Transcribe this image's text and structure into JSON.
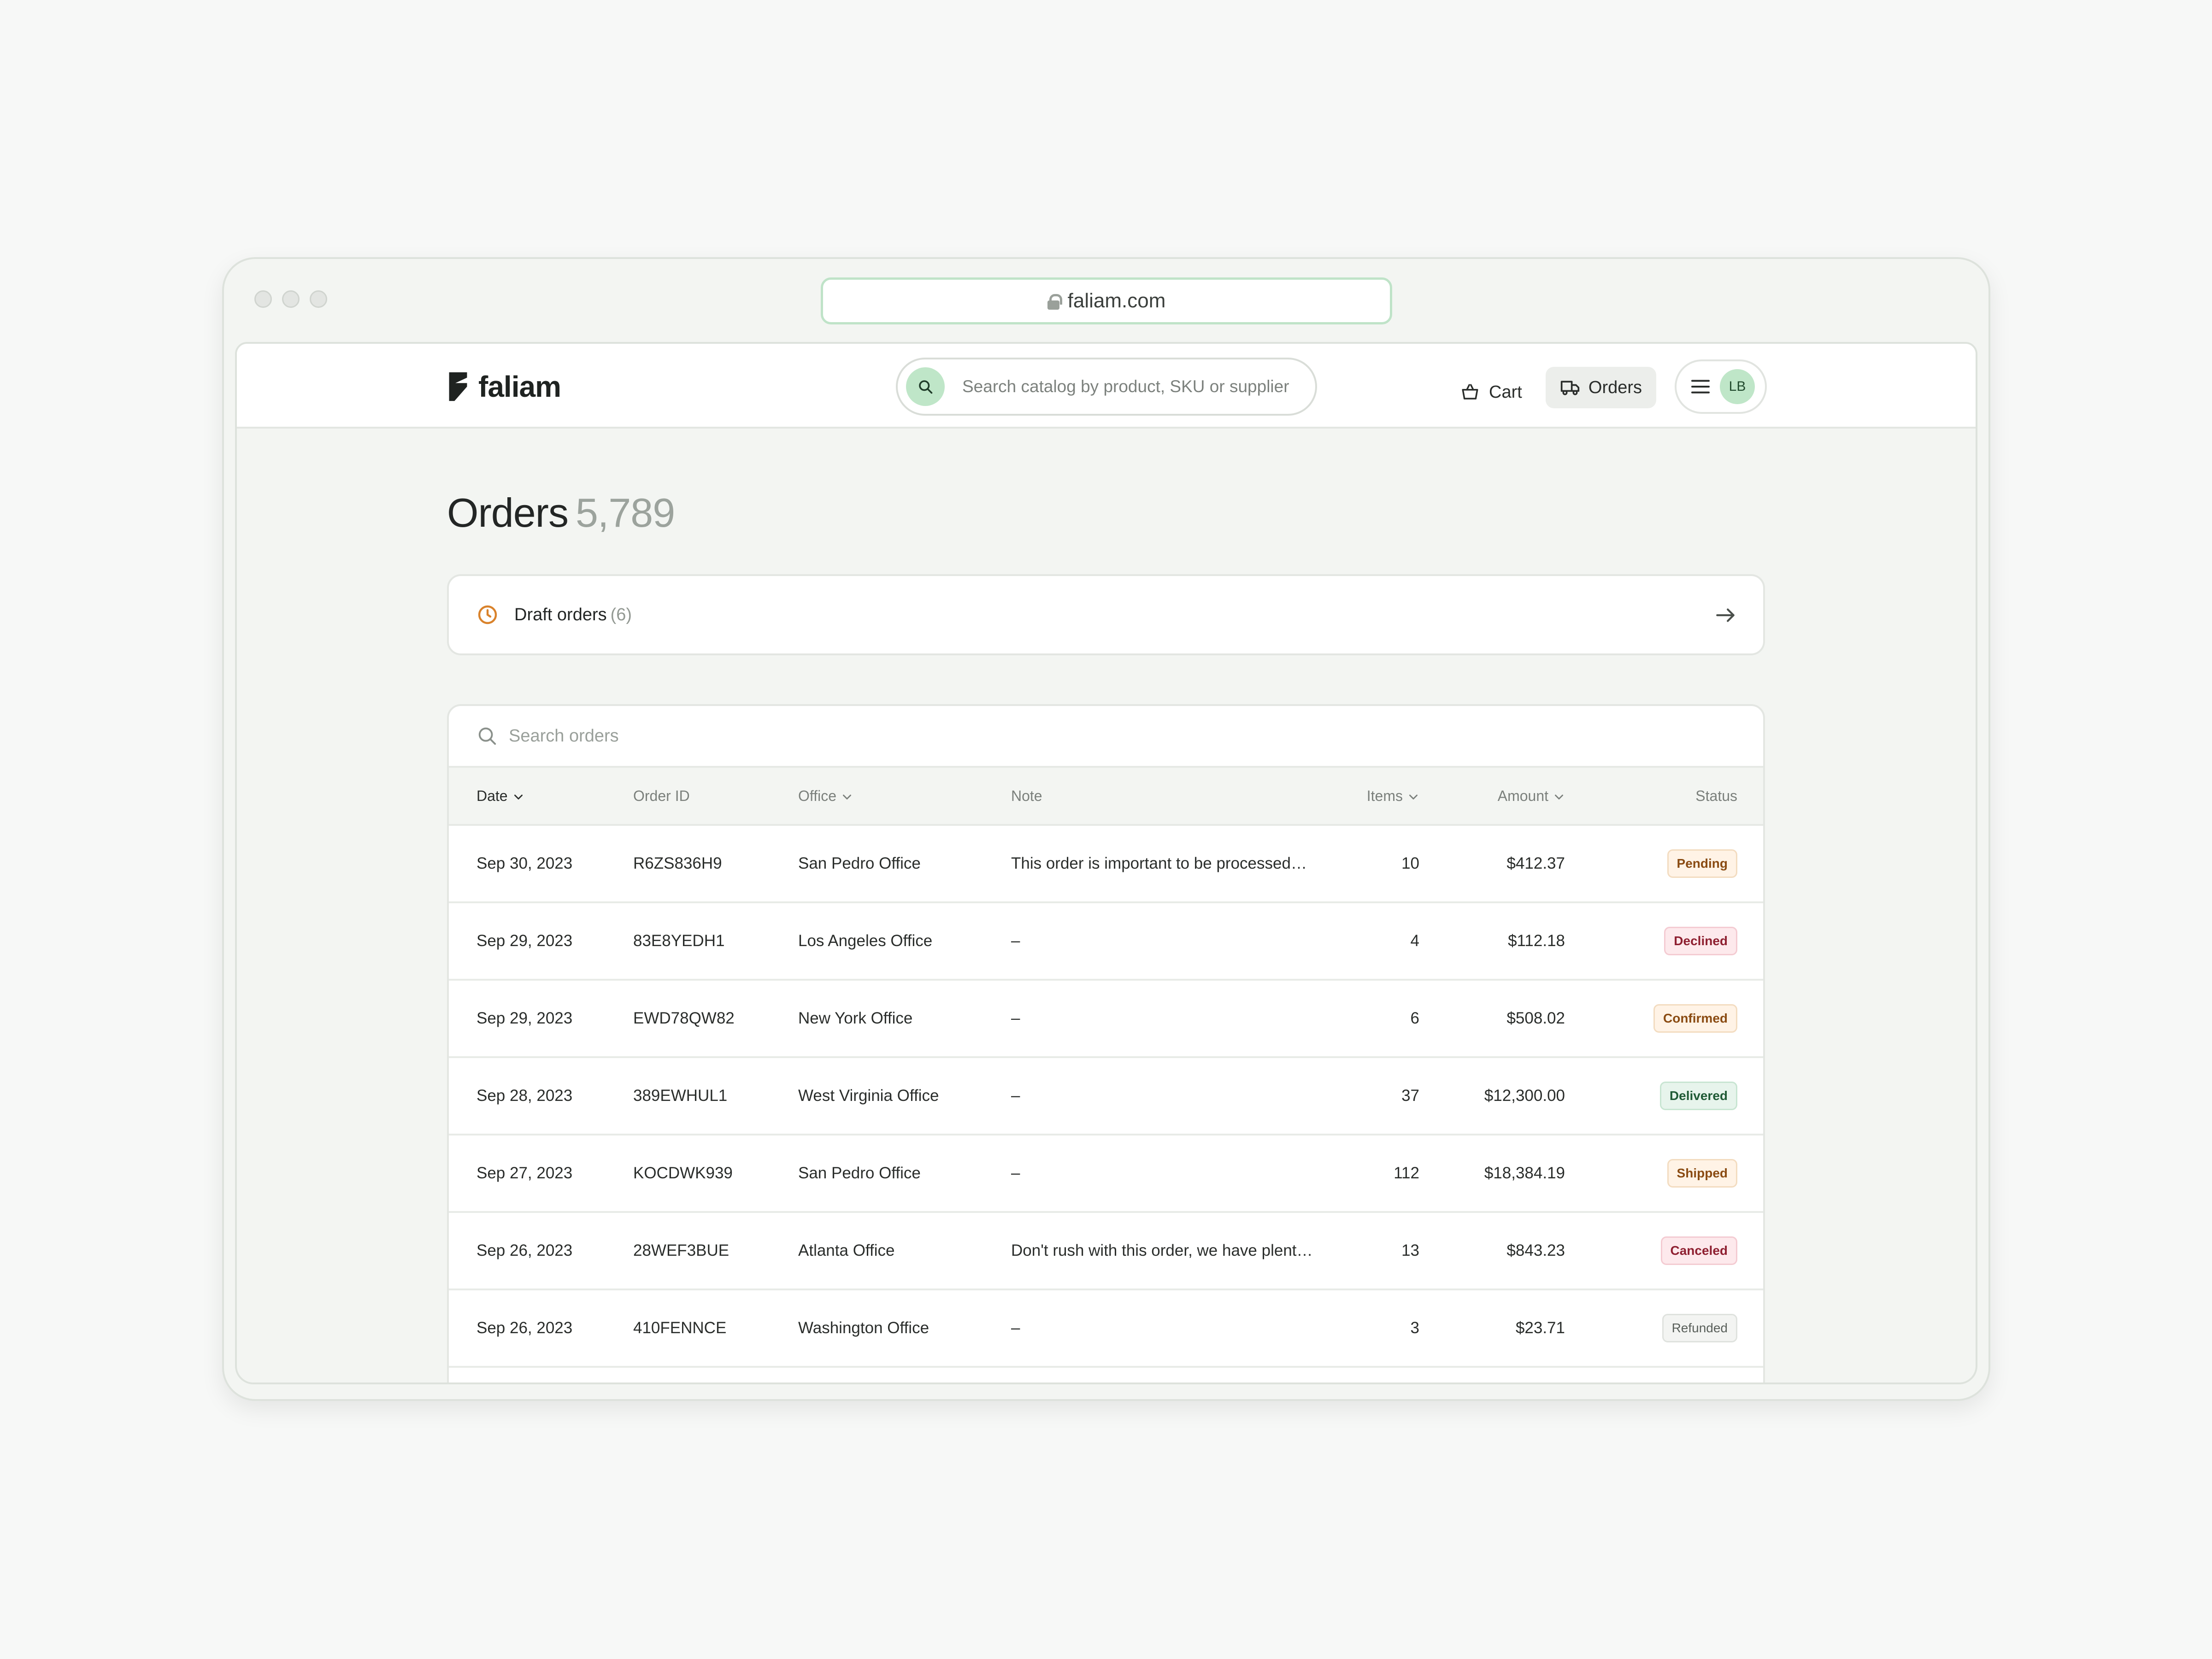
{
  "browser": {
    "url": "faliam.com"
  },
  "header": {
    "logo_text": "faliam",
    "search_placeholder": "Search catalog by product, SKU or supplier",
    "cart_label": "Cart",
    "orders_label": "Orders",
    "avatar_initials": "LB"
  },
  "page": {
    "title": "Orders",
    "count": "5,789"
  },
  "drafts": {
    "label": "Draft orders",
    "count": "(6)"
  },
  "orders_search": {
    "placeholder": "Search orders"
  },
  "table": {
    "columns": {
      "date": "Date",
      "order_id": "Order ID",
      "office": "Office",
      "note": "Note",
      "items": "Items",
      "amount": "Amount",
      "status": "Status"
    },
    "rows": [
      {
        "date": "Sep 30, 2023",
        "order_id": "R6ZS836H9",
        "office": "San Pedro Office",
        "note": "This order is important to be processed…",
        "items": "10",
        "amount": "$412.37",
        "status": "Pending"
      },
      {
        "date": "Sep 29, 2023",
        "order_id": "83E8YEDH1",
        "office": "Los Angeles Office",
        "note": "–",
        "items": "4",
        "amount": "$112.18",
        "status": "Declined"
      },
      {
        "date": "Sep 29, 2023",
        "order_id": "EWD78QW82",
        "office": "New York Office",
        "note": "–",
        "items": "6",
        "amount": "$508.02",
        "status": "Confirmed"
      },
      {
        "date": "Sep 28, 2023",
        "order_id": "389EWHUL1",
        "office": "West Virginia Office",
        "note": "–",
        "items": "37",
        "amount": "$12,300.00",
        "status": "Delivered"
      },
      {
        "date": "Sep 27, 2023",
        "order_id": "KOCDWK939",
        "office": "San Pedro Office",
        "note": "–",
        "items": "112",
        "amount": "$18,384.19",
        "status": "Shipped"
      },
      {
        "date": "Sep 26, 2023",
        "order_id": "28WEF3BUE",
        "office": "Atlanta Office",
        "note": "Don't rush with this order, we have plenty…",
        "items": "13",
        "amount": "$843.23",
        "status": "Canceled"
      },
      {
        "date": "Sep 26, 2023",
        "order_id": "410FENNCE",
        "office": "Washington Office",
        "note": "–",
        "items": "3",
        "amount": "$23.71",
        "status": "Refunded"
      }
    ]
  },
  "icons": {
    "logo": "faliam-logo-mark",
    "search": "search-icon",
    "cart": "basket-icon",
    "orders": "truck-icon",
    "menu": "hamburger-icon",
    "drafts": "clock-icon",
    "drafts_arrow": "arrow-right-icon",
    "sort": "chevron-down-icon"
  },
  "colors": {
    "accent_green": "#bfe6c8",
    "clock_orange": "#d9822b",
    "page_bg": "#f3f5f2"
  }
}
